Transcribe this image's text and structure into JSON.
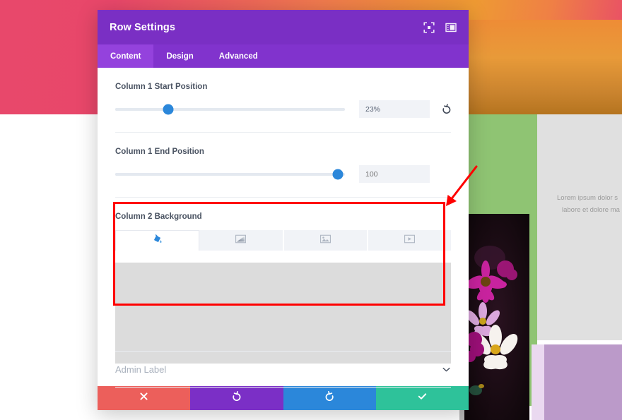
{
  "window": {
    "title": "Row Settings",
    "header_icons": [
      {
        "name": "focus-icon",
        "glyph": "focus"
      },
      {
        "name": "layout-panel-icon",
        "glyph": "layout"
      }
    ]
  },
  "tabs": [
    {
      "label": "Content",
      "active": true
    },
    {
      "label": "Design",
      "active": false
    },
    {
      "label": "Advanced",
      "active": false
    }
  ],
  "fields": {
    "column1_start": {
      "label": "Column 1 Start Position",
      "value": "23%",
      "slider_percent": 23,
      "is_placeholder": false,
      "has_reset": true
    },
    "column1_end": {
      "label": "Column 1 End Position",
      "value": "100",
      "slider_percent": 97,
      "is_placeholder": true,
      "has_reset": false
    },
    "column2_background": {
      "label": "Column 2 Background",
      "tabs": [
        {
          "name": "background-color-tab",
          "icon": "paint-bucket-icon",
          "active": true
        },
        {
          "name": "background-gradient-tab",
          "icon": "gradient-icon",
          "active": false
        },
        {
          "name": "background-image-tab",
          "icon": "image-icon",
          "active": false
        },
        {
          "name": "background-video-tab",
          "icon": "video-icon",
          "active": false
        }
      ]
    }
  },
  "admin": {
    "label": "Admin Label",
    "chevron": "chevron-down-icon"
  },
  "footer": {
    "buttons": [
      {
        "name": "cancel-button",
        "icon": "close-icon",
        "color": "#ec5f5b"
      },
      {
        "name": "undo-button",
        "icon": "undo-icon",
        "color": "#7b2fc6"
      },
      {
        "name": "redo-button",
        "icon": "redo-icon",
        "color": "#2b87da"
      },
      {
        "name": "save-button",
        "icon": "check-icon",
        "color": "#2ec29a"
      }
    ]
  },
  "background_page": {
    "lorem_line1": "Lorem ipsum dolor s",
    "lorem_line2": "labore et dolore ma"
  },
  "annotation": {
    "highlight_color": "#ff0000",
    "arrow_color": "#ff0000"
  },
  "colors": {
    "header_purple": "#7a2fc4",
    "tabbar_purple": "#8133cd",
    "active_tab_purple": "#9442dd",
    "slider_blue": "#2b87da",
    "field_grey": "#f1f3f7",
    "swatch_grey": "#dcdcdc"
  }
}
